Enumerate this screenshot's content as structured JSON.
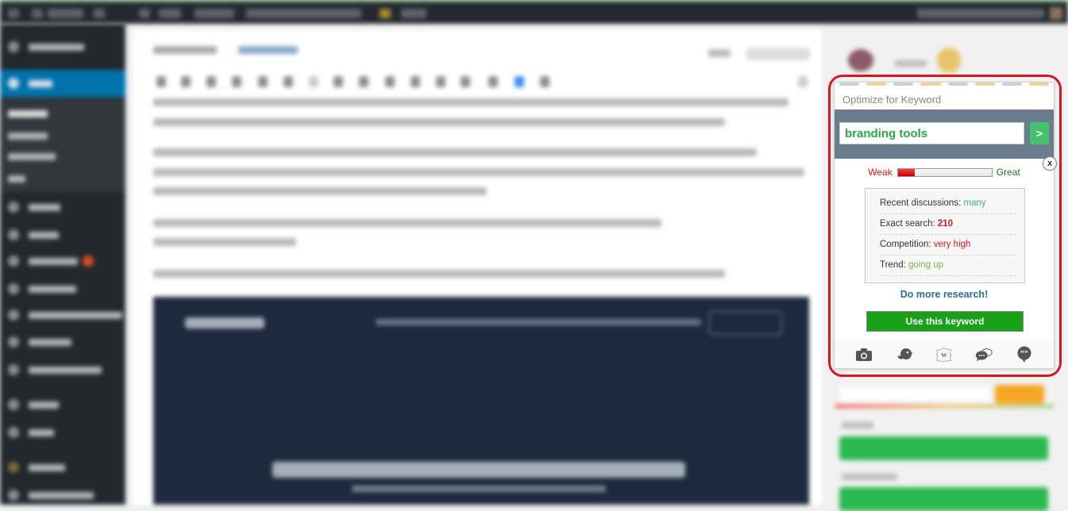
{
  "background": {
    "note": "blurred WordPress post editor"
  },
  "popup": {
    "title": "Optimize for Keyword",
    "keyword_input_value": "branding tools",
    "go_button_label": ">",
    "close_label": "x",
    "meter": {
      "low_label": "Weak",
      "high_label": "Great",
      "strength_fraction": 0.18
    },
    "stats": [
      {
        "label": "Recent discussions:",
        "value": "many"
      },
      {
        "label": "Exact search:",
        "value": "210"
      },
      {
        "label": "Competition:",
        "value": "very high"
      },
      {
        "label": "Trend:",
        "value": "going up"
      }
    ],
    "research_link": "Do more research!",
    "use_button_label": "Use this keyword",
    "bottom_icons": [
      "camera-icon",
      "twitter-bird-icon",
      "wikipedia-puzzle-icon",
      "chat-bubbles-icon",
      "quote-bubble-icon"
    ]
  },
  "colors": {
    "highlight_ring": "#d9161c",
    "keyword_text": "#2ba84a",
    "use_button": "#19a119",
    "band": "#6b7d8c"
  }
}
